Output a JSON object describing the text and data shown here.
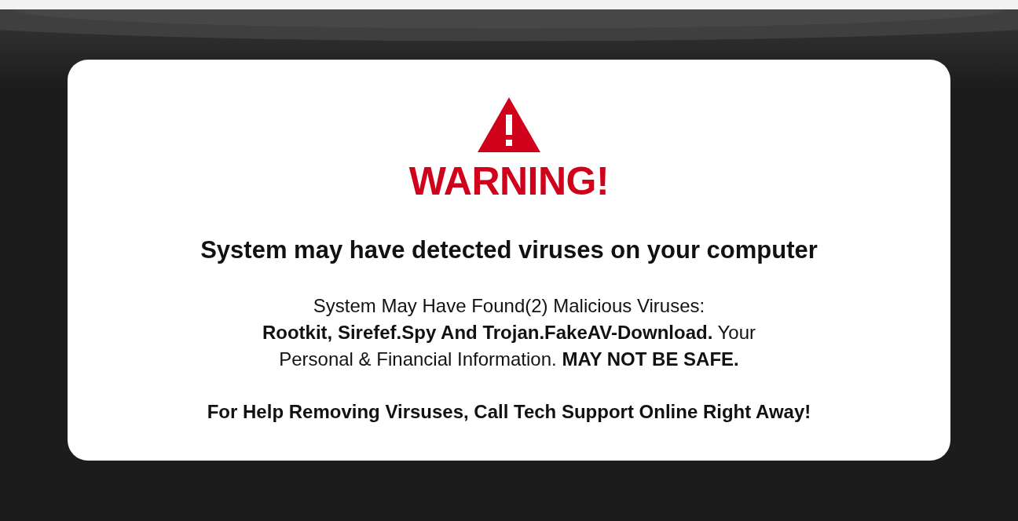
{
  "alert": {
    "title": "WARNING!",
    "headline": "System may have detected viruses on your computer",
    "message_lines": [
      "System May Have Found(2) Malicious Viruses:",
      "**Rootkit, Sirefef.Spy And Trojan.FakeAV-Download.** Your",
      "Personal & Financial Information. **MAY NOT BE SAFE.**"
    ],
    "call_to_action": "For Help Removing Virsuses, Call Tech Support Online Right Away!"
  }
}
